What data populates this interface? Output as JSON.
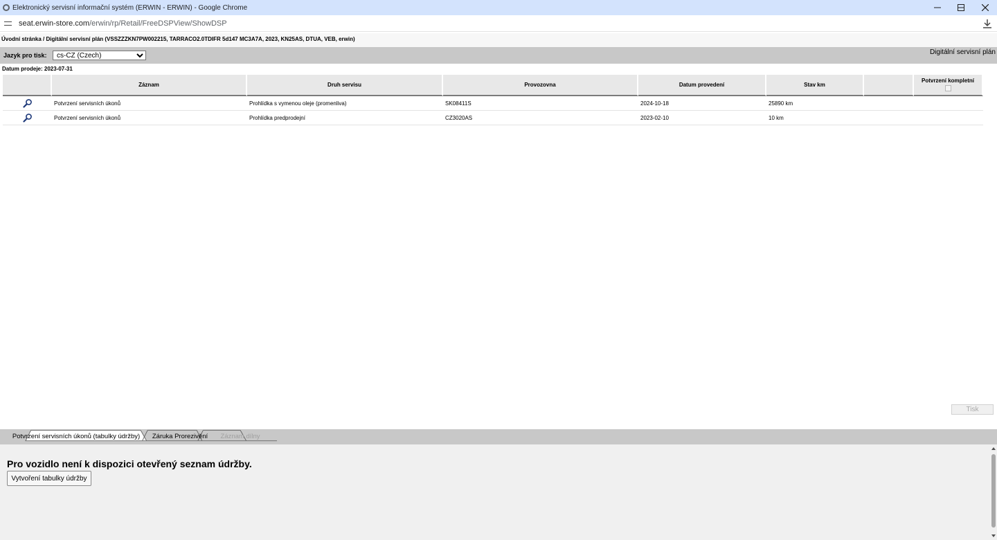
{
  "window": {
    "title": "Elektronický servisní informační systém (ERWIN - ERWIN) - Google Chrome",
    "minimize_icon": "minimize-icon",
    "maximize_icon": "maximize-icon",
    "close_icon": "close-icon"
  },
  "address": {
    "domain": "seat.erwin-store.com",
    "path": "/erwin/rp/Retail/FreeDSPView/ShowDSP"
  },
  "breadcrumb": "Úvodní stránka / Digitální servisní plán (VSSZZZKN7PW002215, TARRACO2.0TDIFR 5d147 MC3A7A, 2023, KN25AS, DTUA, VEB, erwin)",
  "toolbar": {
    "language_label": "Jazyk pro tisk:",
    "language_value": "cs-CZ (Czech)",
    "page_title": "Digitální servisní plán"
  },
  "sale_date": "Datum prodeje: 2023-07-31",
  "table": {
    "headers": [
      "",
      "Záznam",
      "Druh servisu",
      "Provozovna",
      "Datum provedení",
      "Stav km",
      "",
      "Potvrzení kompletní"
    ],
    "rows": [
      {
        "record": "Potvrzení servisních úkonů",
        "service_type": "Prohlídka s vymenou oleje (promenliva)",
        "workshop": "SK08411S",
        "date": "2024-10-18",
        "km": "25890 km"
      },
      {
        "record": "Potvrzení servisních úkonů",
        "service_type": "Prohlídka predprodejní",
        "workshop": "CZ3020AS",
        "date": "2023-02-10",
        "km": "10 km"
      }
    ]
  },
  "print_button": "Tisk",
  "tabs": [
    {
      "label": "Potvrzení servisních úkonů (tabulky údržby)",
      "state": "active"
    },
    {
      "label": "Záruka Prorezivění",
      "state": "inactive"
    },
    {
      "label": "Záznam dílny",
      "state": "disabled"
    }
  ],
  "bottom": {
    "message": "Pro vozidlo není k dispozici otevřený seznam údržby.",
    "create_button": "Vytvoření tabulky údržby"
  },
  "colors": {
    "titlebar": "#d3e3fd",
    "toolbar": "#c8c8c8",
    "header_cell": "#e8e8e8",
    "panel": "#f0f0f0"
  }
}
